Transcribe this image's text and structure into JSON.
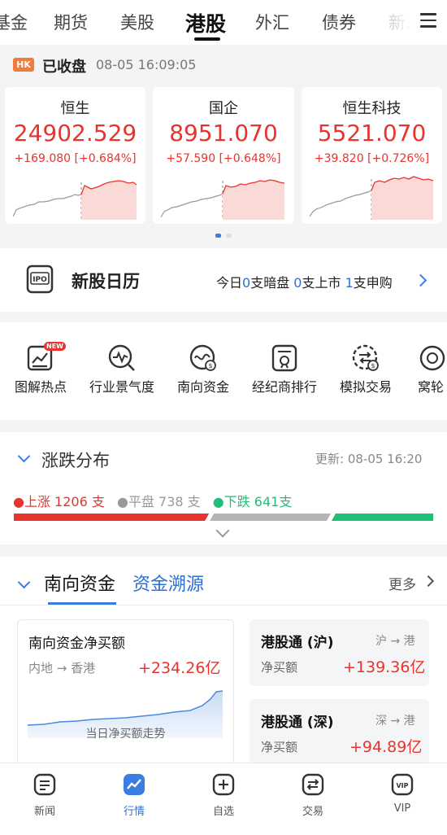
{
  "top_tabs": [
    "基金",
    "期货",
    "美股",
    "港股",
    "外汇",
    "债券",
    "新."
  ],
  "status": {
    "badge": "HK",
    "text": "已收盘",
    "time": "08-05 16:09:05"
  },
  "indices": [
    {
      "name": "恒生",
      "value": "24902.529",
      "change": "+169.080 [+0.684%]"
    },
    {
      "name": "国企",
      "value": "8951.070",
      "change": "+57.590 [+0.648%]"
    },
    {
      "name": "恒生科技",
      "value": "5521.070",
      "change": "+39.820 [+0.726%]"
    }
  ],
  "ipo": {
    "title": "新股日历",
    "info_parts": [
      "今日",
      "0",
      "支暗盘 ",
      "0",
      "支上市 ",
      "1",
      "支申购"
    ]
  },
  "tools": [
    "图解热点",
    "行业景气度",
    "南向资金",
    "经纪商排行",
    "模拟交易",
    "窝轮"
  ],
  "tools_new_badge": "NEW",
  "breadth": {
    "title": "涨跌分布",
    "updated": "更新: 08-05 16:20",
    "up": "上涨 1206 支",
    "flat": "平盘 738 支",
    "down": "下跌 641支",
    "up_count": 1206,
    "flat_count": 738,
    "down_count": 641,
    "colors": {
      "up": "#e8342f",
      "flat": "#b4b4b4",
      "down": "#1fbf78"
    }
  },
  "southbound": {
    "tabs": [
      "南向资金",
      "资金溯源"
    ],
    "more": "更多",
    "net_buy": {
      "title": "南向资金净买额",
      "direction": "内地 → 香港",
      "value": "+234.26亿",
      "chart_caption": "当日净买额走势"
    },
    "connects": [
      {
        "title": "港股通 (沪)",
        "route": "沪 → 港",
        "label": "净买额",
        "value": "+139.36亿"
      },
      {
        "title": "港股通 (深)",
        "route": "深 → 港",
        "label": "净买额",
        "value": "+94.89亿"
      }
    ]
  },
  "bottom_nav": [
    "新闻",
    "行情",
    "自选",
    "交易",
    "VIP"
  ]
}
